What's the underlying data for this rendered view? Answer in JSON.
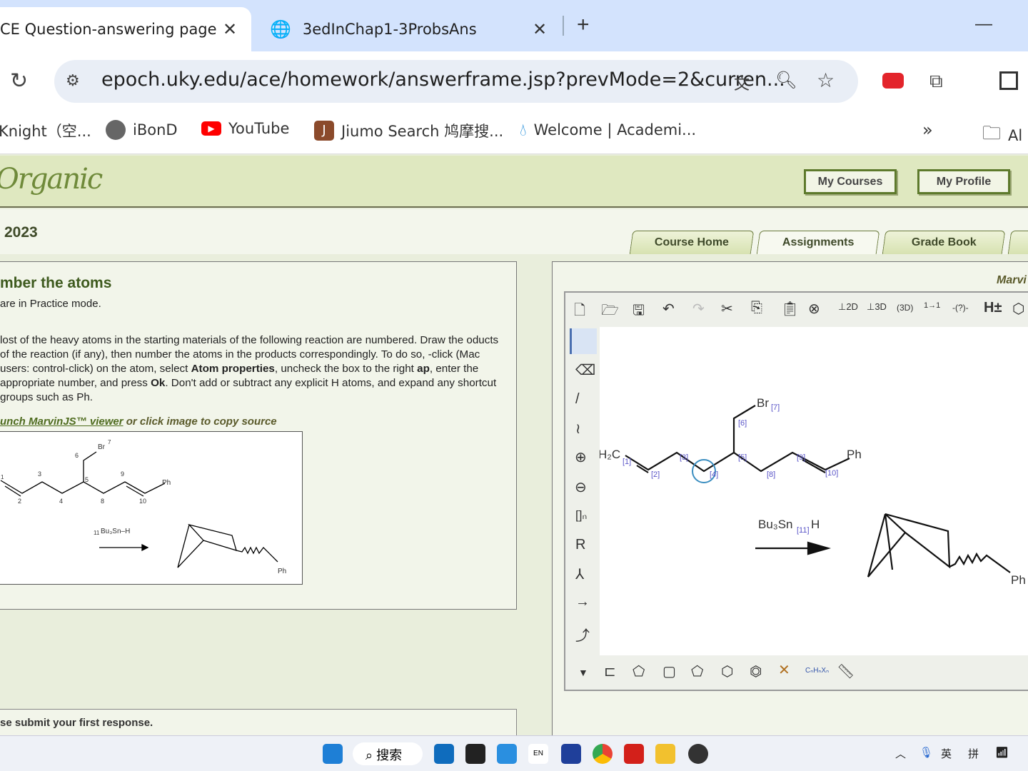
{
  "browser": {
    "tabs": [
      {
        "title": "CE Question-answering page"
      },
      {
        "title": "3edInChap1-3ProbsAns"
      }
    ],
    "url": "epoch.uky.edu/ace/homework/answerframe.jsp?prevMode=2&curren...",
    "bookmarks": [
      "Knight（空...",
      "iBonD",
      "YouTube",
      "Jiumo Search 鸠摩搜...",
      "Welcome | Academi...",
      "Al"
    ]
  },
  "header": {
    "logo": "Organic",
    "my_courses": "My Courses",
    "my_profile": "My Profile",
    "year": "2023",
    "nav_tabs": [
      "Course Home",
      "Assignments",
      "Grade Book"
    ]
  },
  "question": {
    "title": "mber the atoms",
    "mode": "are in Practice mode.",
    "instr": [
      {
        "t": "lost of the heavy atoms in the starting materials of the following reaction are numbered. Draw the oducts of the reaction (if any), then number the atoms in the products correspondingly. To do so, -click (Mac users: control-click) on the atom, select ",
        "b": false
      },
      {
        "t": "Atom properties",
        "b": true
      },
      {
        "t": ", uncheck the box to the right ",
        "b": false
      },
      {
        "t": "ap",
        "b": true
      },
      {
        "t": ", enter the appropriate number, and press ",
        "b": false
      },
      {
        "t": "Ok",
        "b": true
      },
      {
        "t": ". Don't add or subtract any explicit H atoms, and  expand any shortcut groups such as Ph.",
        "b": false
      }
    ],
    "launch_link": "unch MarvinJS™ viewer",
    "launch_rest": " or click image to copy source",
    "image_labels": {
      "br": "Br",
      "n7": "7",
      "n6": "6",
      "n3": "3",
      "n5": "5",
      "n9": "9",
      "n2": "2",
      "n4": "4",
      "n8": "8",
      "n10": "10",
      "n1": "1",
      "ph": "Ph",
      "reagent": "Bu₃Sn–H",
      "n11": "11",
      "ph2": "Ph"
    },
    "submit_msg": "se submit your first response."
  },
  "marvin": {
    "label": "Marvi",
    "labels": {
      "h2c": "H₂C",
      "br": "Br",
      "ph": "Ph",
      "ph2": "Ph",
      "reagent": "Bu₃Sn",
      "h": "H",
      "maps": [
        "[1]",
        "[2]",
        "[3]",
        "[4]",
        "[5]",
        "[6]",
        "[7]",
        "[8]",
        "[9]",
        "[10]",
        "[11]"
      ]
    }
  },
  "taskbar": {
    "search": "搜索",
    "ime1": "英",
    "ime2": "拼",
    "lang": "EN"
  }
}
